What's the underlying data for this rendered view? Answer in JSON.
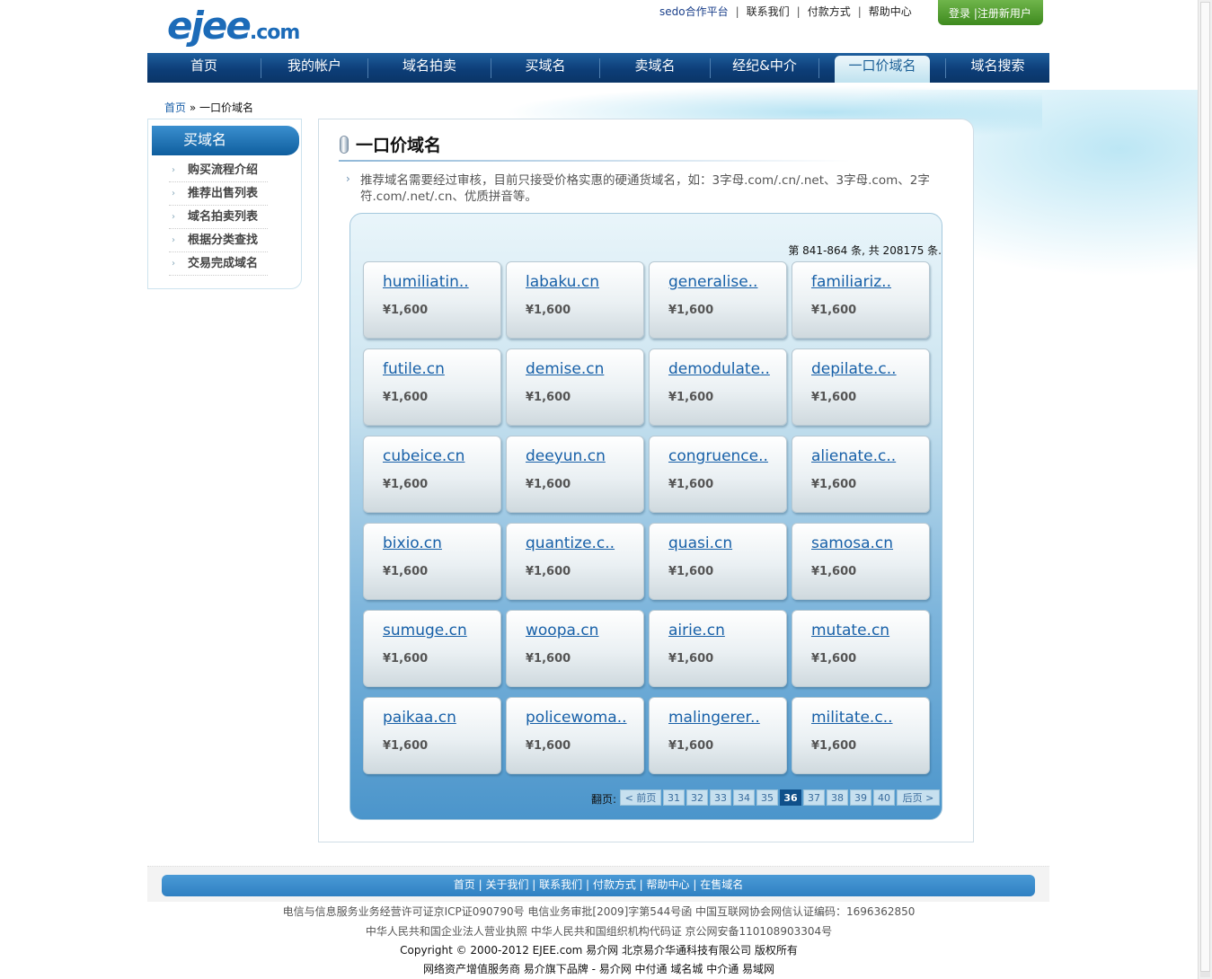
{
  "logo": {
    "main": "ejee",
    "suffix": ".com"
  },
  "toplinks": [
    "sedo合作平台",
    "联系我们",
    "付款方式",
    "帮助中心"
  ],
  "login": {
    "login": "登录",
    "sep": "|",
    "register": "注册新用户"
  },
  "nav": [
    "首页",
    "我的帐户",
    "域名拍卖",
    "买域名",
    "卖域名",
    "经纪&中介",
    "一口价域名",
    "域名搜索"
  ],
  "breadcrumb": {
    "home": "首页",
    "sep": "»",
    "current": "一口价域名"
  },
  "sidebar": {
    "title": "买域名",
    "items": [
      "购买流程介绍",
      "推荐出售列表",
      "域名拍卖列表",
      "根据分类查找",
      "交易完成域名"
    ]
  },
  "main": {
    "title": "一口价域名",
    "notice": "推荐域名需要经过审核，目前只接受价格实惠的硬通货域名，如：3字母.com/.cn/.net、3字母.com、2字符.com/.net/.cn、优质拼音等。",
    "count": "第  841-864 条, 共  208175 条."
  },
  "domains": [
    {
      "name": "humiliatin..",
      "price": "¥1,600"
    },
    {
      "name": "labaku.cn",
      "price": "¥1,600"
    },
    {
      "name": "generalise..",
      "price": "¥1,600"
    },
    {
      "name": "familiariz..",
      "price": "¥1,600"
    },
    {
      "name": "futile.cn",
      "price": "¥1,600"
    },
    {
      "name": "demise.cn",
      "price": "¥1,600"
    },
    {
      "name": "demodulate..",
      "price": "¥1,600"
    },
    {
      "name": "depilate.c..",
      "price": "¥1,600"
    },
    {
      "name": "cubeice.cn",
      "price": "¥1,600"
    },
    {
      "name": "deeyun.cn",
      "price": "¥1,600"
    },
    {
      "name": "congruence..",
      "price": "¥1,600"
    },
    {
      "name": "alienate.c..",
      "price": "¥1,600"
    },
    {
      "name": "bixio.cn",
      "price": "¥1,600"
    },
    {
      "name": "quantize.c..",
      "price": "¥1,600"
    },
    {
      "name": "quasi.cn",
      "price": "¥1,600"
    },
    {
      "name": "samosa.cn",
      "price": "¥1,600"
    },
    {
      "name": "sumuge.cn",
      "price": "¥1,600"
    },
    {
      "name": "woopa.cn",
      "price": "¥1,600"
    },
    {
      "name": "airie.cn",
      "price": "¥1,600"
    },
    {
      "name": "mutate.cn",
      "price": "¥1,600"
    },
    {
      "name": "paikaa.cn",
      "price": "¥1,600"
    },
    {
      "name": "policewoma..",
      "price": "¥1,600"
    },
    {
      "name": "malingerer..",
      "price": "¥1,600"
    },
    {
      "name": "militate.c..",
      "price": "¥1,600"
    }
  ],
  "pager": {
    "label": "翻页:",
    "prev": "< 前页",
    "pages": [
      "31",
      "32",
      "33",
      "34",
      "35",
      "36",
      "37",
      "38",
      "39",
      "40"
    ],
    "current": "36",
    "next": "后页  >"
  },
  "footer": {
    "links": [
      "首页",
      "关于我们",
      "联系我们",
      "付款方式",
      "帮助中心",
      "在售域名"
    ],
    "line1": "电信与信息服务业务经营许可证京ICP证090790号 电信业务审批[2009]字第544号函 中国互联网协会网信认证编码：1696362850",
    "line2": "中华人民共和国企业法人营业执照 中华人民共和国组织机构代码证 京公网安备110108903304号",
    "line3": "Copyright © 2000-2012 EJEE.com 易介网 北京易介华通科技有限公司 版权所有",
    "line4": "网络资产增值服务商 易介旗下品牌 - 易介网 中付通 域名城 中介通 易域网"
  }
}
